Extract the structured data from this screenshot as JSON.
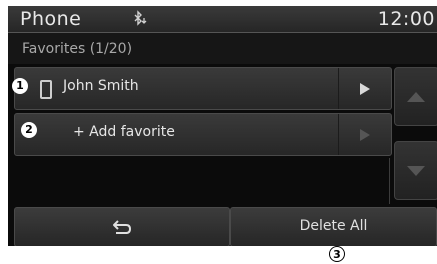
{
  "statusbar": {
    "app_title": "Phone",
    "clock": "12:00",
    "bt_icon": "bluetooth-download-icon"
  },
  "list": {
    "header": "Favorites (1/20)",
    "rows": [
      {
        "label": "John Smith",
        "icon": "phone-icon",
        "arrow_enabled": true
      },
      {
        "label": "+ Add favorite",
        "arrow_enabled": false
      }
    ]
  },
  "bottom": {
    "back_icon": "back-arrow-icon",
    "delete_all": "Delete All"
  },
  "callouts": [
    "1",
    "2",
    "3"
  ],
  "colors": {
    "background": "#0b0b0b",
    "text": "#e6e6e6",
    "muted": "#a8a8a8"
  }
}
